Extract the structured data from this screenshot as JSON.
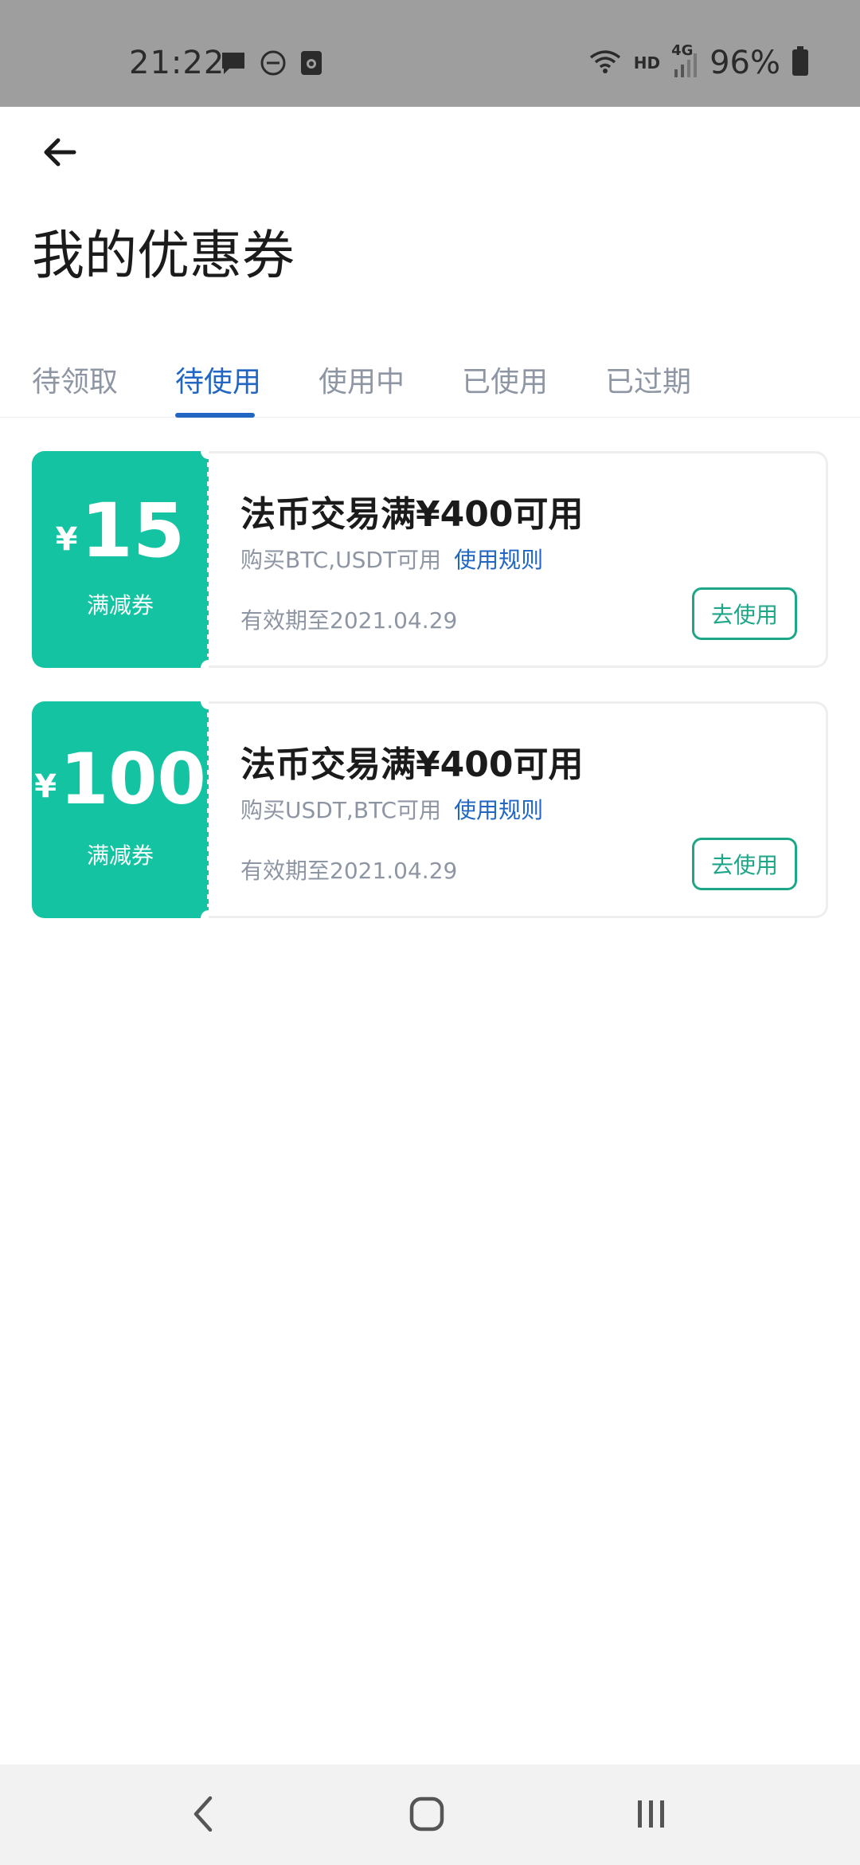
{
  "status_bar": {
    "time": "21:22",
    "battery": "96%",
    "hd_label": "HD",
    "network_label": "4G",
    "icons_left": [
      "message-icon",
      "dnd-icon",
      "screen-record-icon"
    ],
    "icons_right": [
      "wifi-icon",
      "signal-icon",
      "battery-icon"
    ]
  },
  "header": {
    "title": "我的优惠券"
  },
  "tabs": [
    {
      "label": "待领取",
      "active": false
    },
    {
      "label": "待使用",
      "active": true
    },
    {
      "label": "使用中",
      "active": false
    },
    {
      "label": "已使用",
      "active": false
    },
    {
      "label": "已过期",
      "active": false
    }
  ],
  "coupons": [
    {
      "currency": "¥",
      "amount": "15",
      "type": "满减券",
      "title": "法币交易满¥400可用",
      "desc": "购买BTC,USDT可用",
      "rule_label": "使用规则",
      "validity": "有效期至2021.04.29",
      "action_label": "去使用"
    },
    {
      "currency": "¥",
      "amount": "100",
      "type": "满减券",
      "title": "法币交易满¥400可用",
      "desc": "购买USDT,BTC可用",
      "rule_label": "使用规则",
      "validity": "有效期至2021.04.29",
      "action_label": "去使用"
    }
  ],
  "colors": {
    "accent_blue": "#2066c2",
    "coupon_green": "#13c3a1",
    "button_green": "#1ea688",
    "muted_text": "#8e96a3"
  },
  "nav_bar": {
    "buttons": [
      "back-nav-icon",
      "home-nav-icon",
      "recents-nav-icon"
    ]
  }
}
